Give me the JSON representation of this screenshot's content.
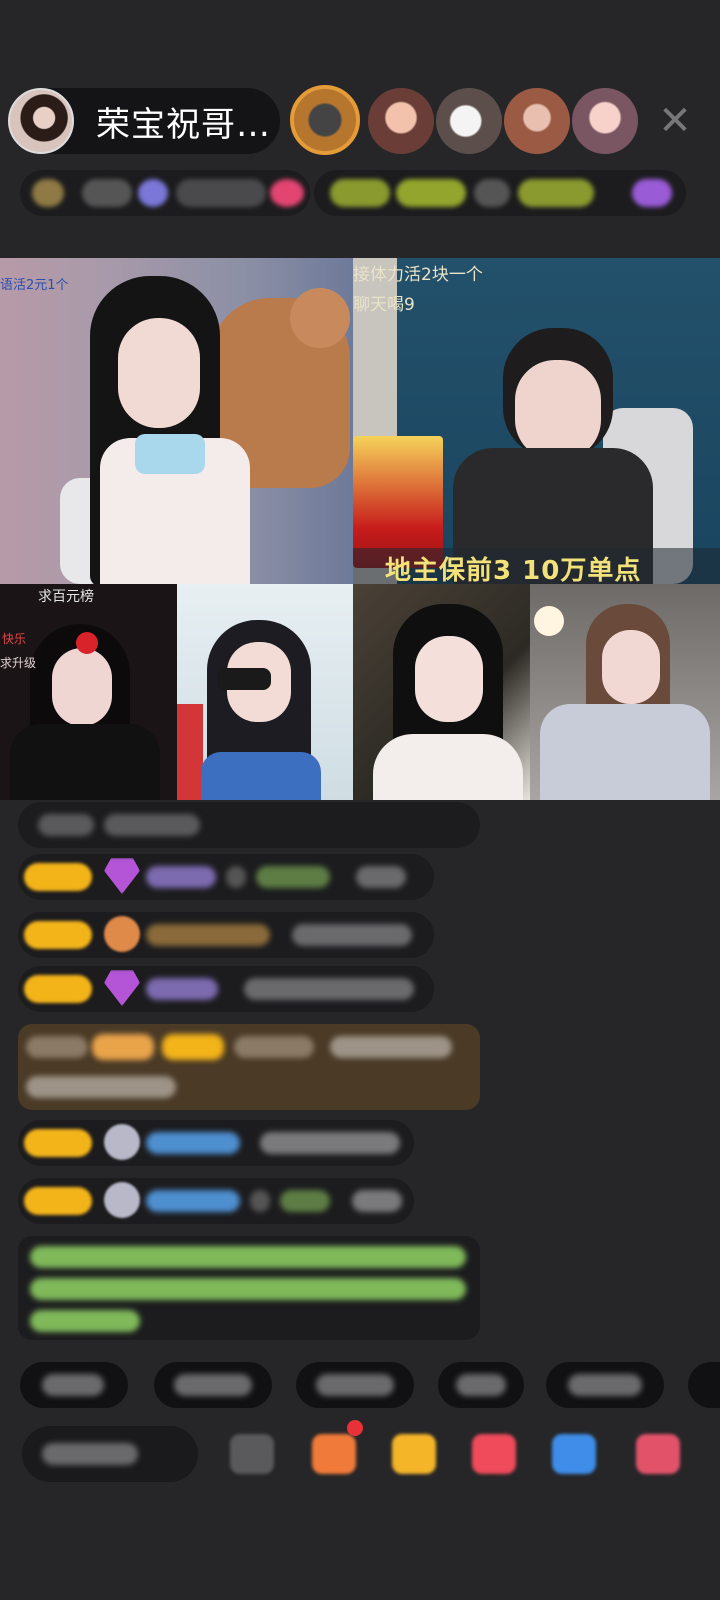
{
  "host": {
    "name": "荣宝祝哥…"
  },
  "header": {
    "close_icon": "close-icon"
  },
  "rooms": {
    "room1": {
      "overlay": "语活2元1个"
    },
    "room2": {
      "overlay_line1": "接体力活2块一个",
      "overlay_line2": "聊天喝9",
      "banner": "地主保前3 10万单点"
    },
    "room3": {
      "overlay_top": "求百元榜",
      "overlay_line1": "快乐",
      "overlay_line2": "求升级"
    }
  },
  "colors": {
    "background": "#262628",
    "badge": "#f3b41a",
    "gem": "#b455d8",
    "system_message": "#4a3a26",
    "green_text": "#7fb95a",
    "blue_text": "#4e8fd0"
  }
}
